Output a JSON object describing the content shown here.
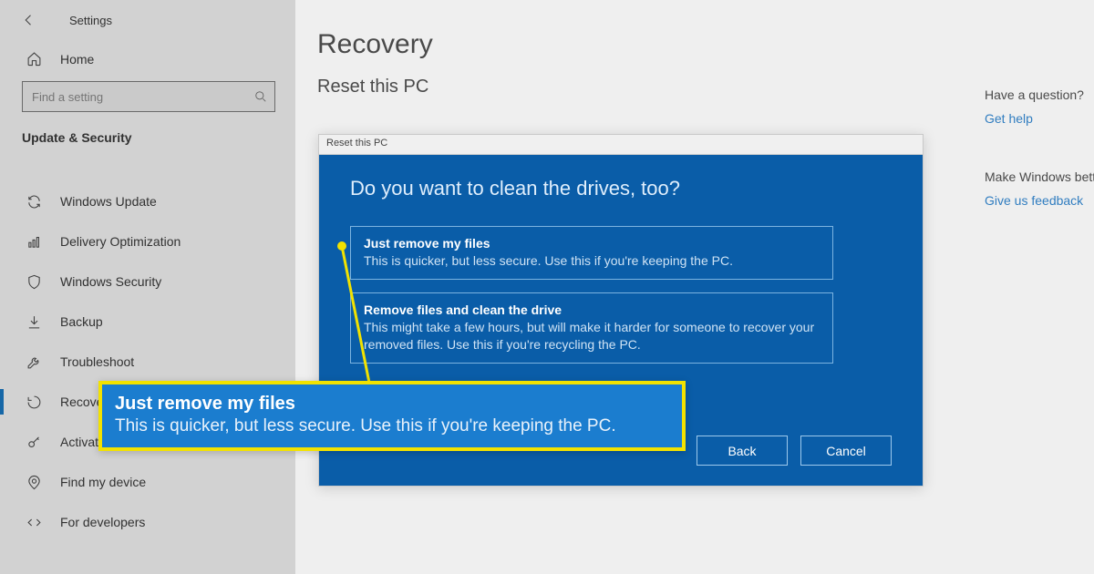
{
  "header": {
    "settings_label": "Settings"
  },
  "sidebar": {
    "home_label": "Home",
    "search_placeholder": "Find a setting",
    "section_label": "Update & Security",
    "items": [
      {
        "label": "Windows Update"
      },
      {
        "label": "Delivery Optimization"
      },
      {
        "label": "Windows Security"
      },
      {
        "label": "Backup"
      },
      {
        "label": "Troubleshoot"
      },
      {
        "label": "Recovery"
      },
      {
        "label": "Activation"
      },
      {
        "label": "Find my device"
      },
      {
        "label": "For developers"
      }
    ],
    "selected_index": 5
  },
  "main": {
    "title": "Recovery",
    "subtitle": "Reset this PC"
  },
  "right_panel": {
    "question1": "Have a question?",
    "link1": "Get help",
    "question2": "Make Windows better",
    "link2": "Give us feedback"
  },
  "dialog": {
    "window_title": "Reset this PC",
    "question": "Do you want to clean the drives, too?",
    "options": [
      {
        "title": "Just remove my files",
        "desc": "This is quicker, but less secure. Use this if you're keeping the PC."
      },
      {
        "title": "Remove files and clean the drive",
        "desc": "This might take a few hours, but will make it harder for someone to recover your removed files. Use this if you're recycling the PC."
      }
    ],
    "back_label": "Back",
    "cancel_label": "Cancel"
  },
  "callout": {
    "title": "Just remove my files",
    "desc": "This is quicker, but less secure. Use this if you're keeping the PC."
  }
}
